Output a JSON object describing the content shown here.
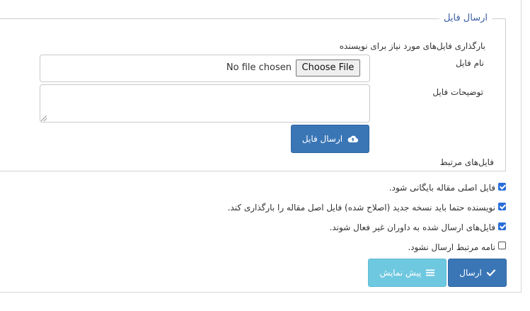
{
  "fieldset": {
    "legend": "ارسال فایل",
    "description": "بارگذاری فایل‌های مورد نیاز برای نویسنده",
    "file_name_label": "نام فایل",
    "file_status": "No file chosen",
    "choose_file_label": "Choose File",
    "file_description_label": "توضیحات فایل",
    "file_description_value": "",
    "upload_button_label": "ارسال فایل",
    "related_files_label": "فایل‌های مرتبط"
  },
  "options": [
    {
      "label": "فایل اصلی مقاله بایگانی شود.",
      "checked": true
    },
    {
      "label": "نویسنده حتما باید نسخه جدید (اصلاح شده) فایل اصل مقاله را بارگذاری کند.",
      "checked": true
    },
    {
      "label": "فایل‌های ارسال شده به داوران غیر فعال شوند.",
      "checked": true
    },
    {
      "label": "نامه مرتبط ارسال نشود.",
      "checked": false
    }
  ],
  "actions": {
    "send_label": "ارسال",
    "preview_label": "پیش نمایش"
  },
  "colors": {
    "primary": "#3a76b6",
    "info": "#6ec8e0",
    "legend": "#3a5ea5",
    "checkbox": "#2a6ed8"
  },
  "icons": {
    "upload": "cloud-upload-icon",
    "send": "check-icon",
    "preview": "menu-lines-icon"
  }
}
